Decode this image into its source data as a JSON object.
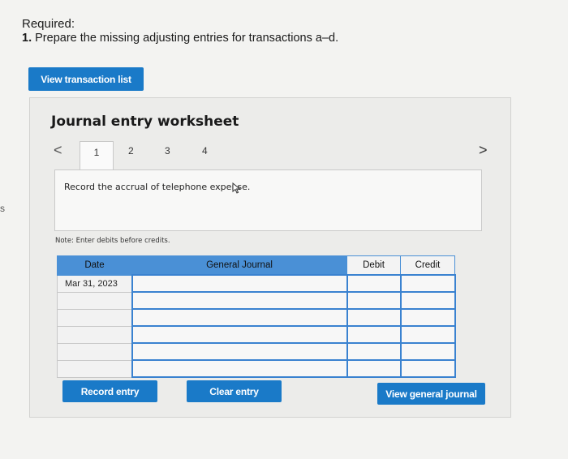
{
  "margin_letter": "s",
  "required": {
    "title": "Required:",
    "number": "1.",
    "text": "Prepare the missing adjusting entries for transactions a–d."
  },
  "buttons": {
    "view_transaction_list": "View transaction list",
    "record_entry": "Record entry",
    "clear_entry": "Clear entry",
    "view_general_journal": "View general journal"
  },
  "worksheet": {
    "title": "Journal entry worksheet",
    "nav_prev": "<",
    "nav_next": ">",
    "tabs": [
      "1",
      "2",
      "3",
      "4"
    ],
    "active_tab": "1",
    "instruction": "Record the accrual of telephone expense.",
    "note": "Note: Enter debits before credits."
  },
  "journal": {
    "headers": {
      "date": "Date",
      "account": "General Journal",
      "debit": "Debit",
      "credit": "Credit"
    },
    "rows": [
      {
        "date": "Mar 31, 2023",
        "account": "",
        "debit": "",
        "credit": ""
      },
      {
        "date": "",
        "account": "",
        "debit": "",
        "credit": ""
      },
      {
        "date": "",
        "account": "",
        "debit": "",
        "credit": ""
      },
      {
        "date": "",
        "account": "",
        "debit": "",
        "credit": ""
      },
      {
        "date": "",
        "account": "",
        "debit": "",
        "credit": ""
      },
      {
        "date": "",
        "account": "",
        "debit": "",
        "credit": ""
      }
    ]
  },
  "colors": {
    "button": "#1a7ac8",
    "table_header": "#4a90d6"
  }
}
